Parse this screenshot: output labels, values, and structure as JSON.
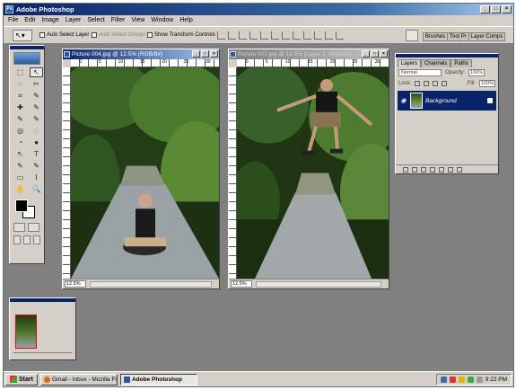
{
  "app": {
    "title": "Adobe Photoshop",
    "window_buttons": [
      "_",
      "□",
      "×"
    ]
  },
  "menu": [
    "File",
    "Edit",
    "Image",
    "Layer",
    "Select",
    "Filter",
    "View",
    "Window",
    "Help"
  ],
  "options": {
    "tool_glyph": "↖▾",
    "auto_select_layer": "Auto Select Layer",
    "auto_select_groups": "Auto Select Groups",
    "show_transform_controls": "Show Transform Controls",
    "well_tabs": [
      "Brushes",
      "Tool Pr",
      "Layer Comps"
    ]
  },
  "toolbox": {
    "tools": [
      "⬚",
      "↖",
      "◌",
      "✂",
      "⌗",
      "✎",
      "✚",
      "✎",
      "✎",
      "✎",
      "◎",
      "◌",
      "◔",
      "●",
      "↖",
      "T",
      "✎",
      "✎",
      "▭",
      "⌇",
      "✋",
      "🔍"
    ]
  },
  "docs": [
    {
      "title": "Picture 004.jpg @ 12.5% (RGB/8#)",
      "zoom": "12.5%",
      "ruler": [
        "0",
        "5",
        "10",
        "15",
        "20",
        "25",
        "30"
      ],
      "active": true
    },
    {
      "title": "Picture 007.jpg @ 12.5% (Layer 1, RGB/8#)",
      "zoom": "12.5%",
      "ruler": [
        "0",
        "5",
        "10",
        "15",
        "20",
        "25",
        "30"
      ],
      "active": false
    }
  ],
  "layers_panel": {
    "tabs": [
      "Layers",
      "Channels",
      "Paths"
    ],
    "blend_mode": "Normal",
    "opacity_label": "Opacity:",
    "opacity_value": "100%",
    "lock_label": "Lock:",
    "fill_label": "Fill:",
    "fill_value": "100%",
    "layer_name": "Background"
  },
  "taskbar": {
    "start": "Start",
    "tasks": [
      "Gmail - Inbox - Mozilla Fir...",
      "Adobe Photoshop"
    ],
    "clock": "9:22 PM"
  },
  "colors": {
    "titlebar": "#0a246a",
    "workspace": "#808080",
    "chrome": "#d4d0c8"
  }
}
